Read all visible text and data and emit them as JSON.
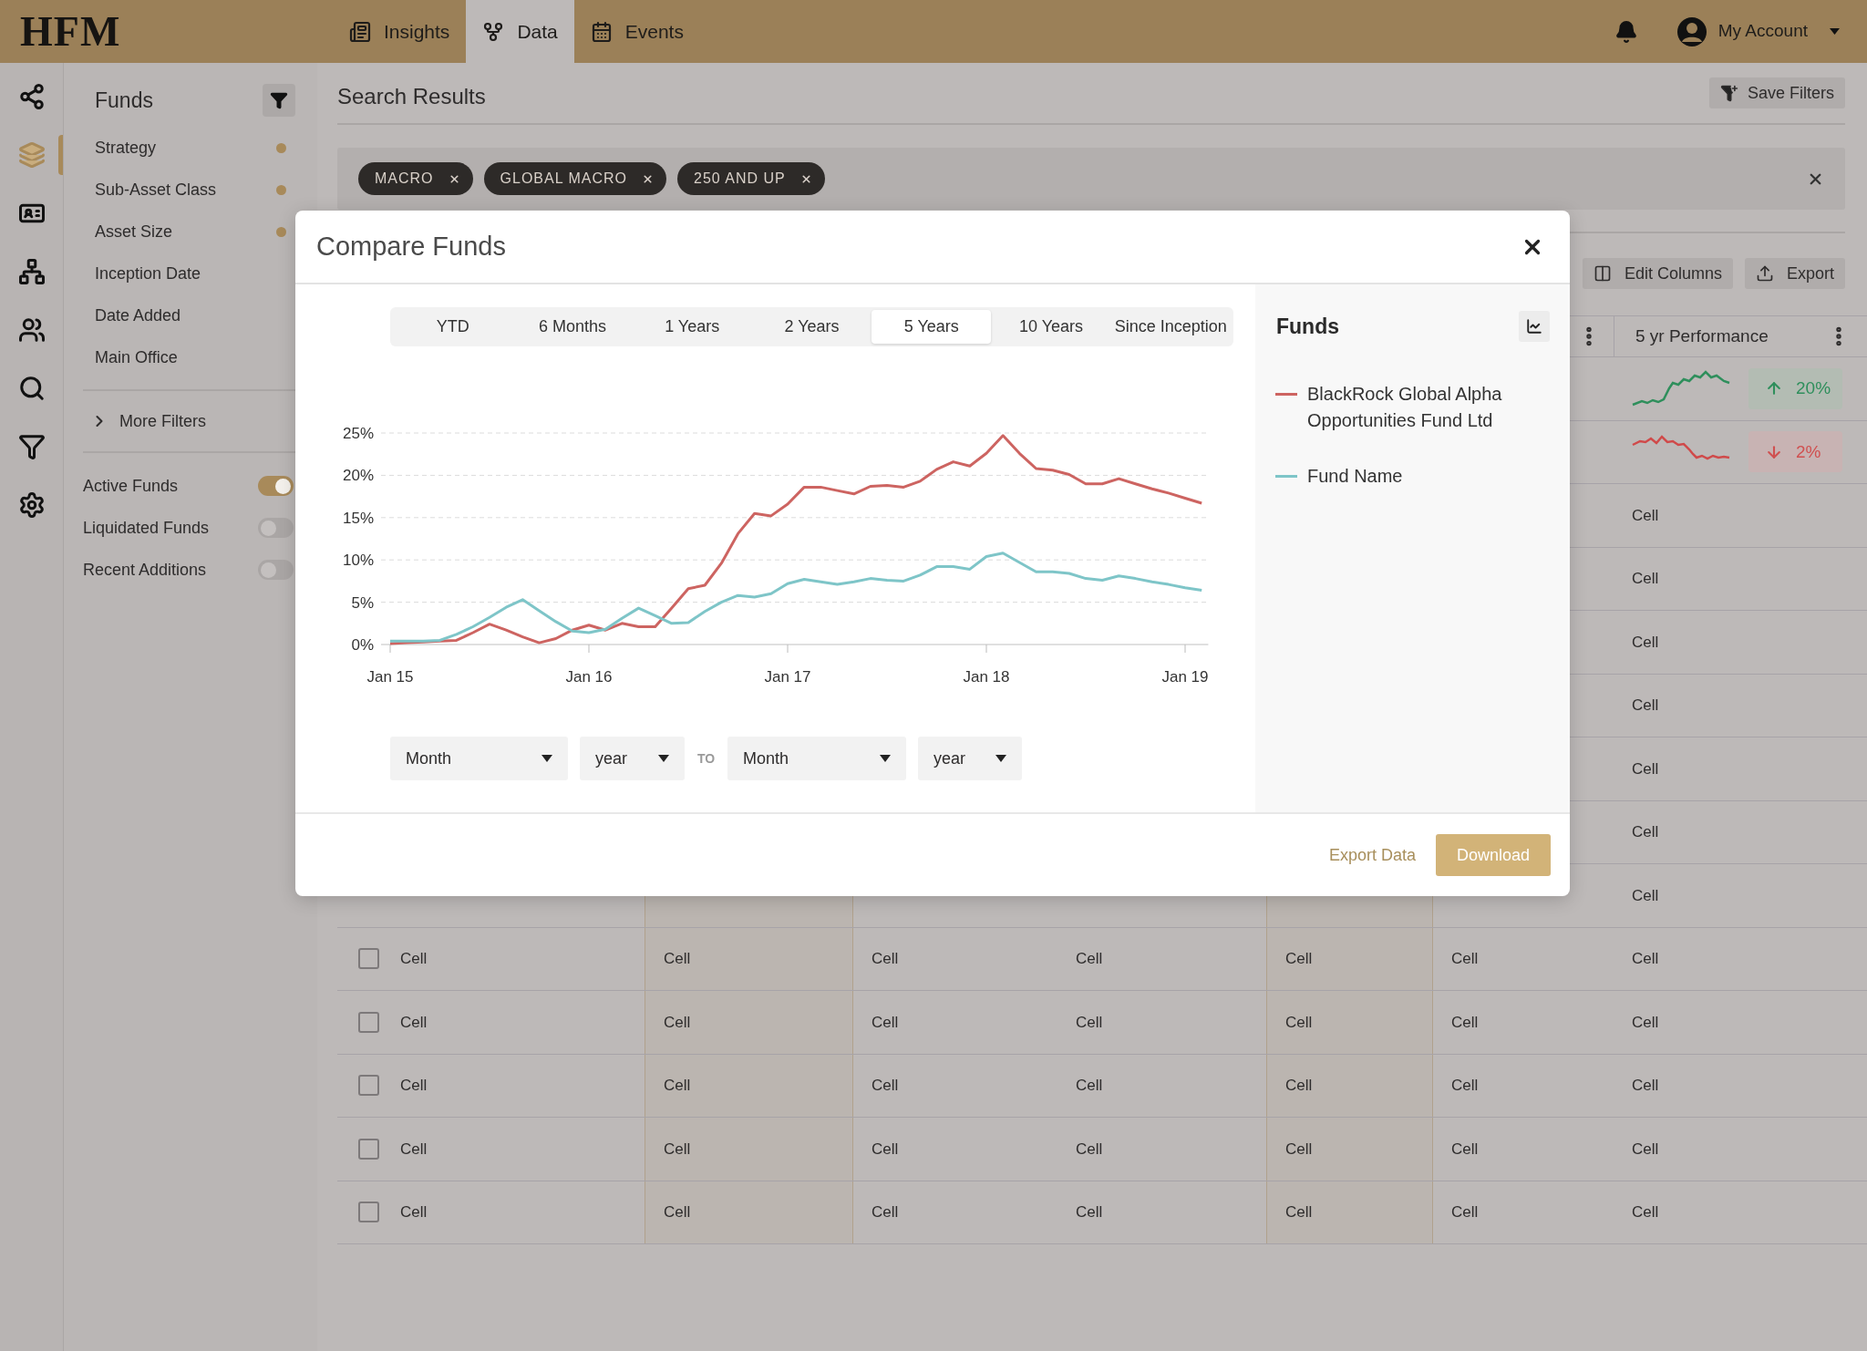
{
  "top_bar": {
    "logo": "HFM",
    "tabs": [
      {
        "label": "Insights",
        "kind": "insights",
        "selected": false
      },
      {
        "label": "Data",
        "kind": "data",
        "selected": true
      },
      {
        "label": "Events",
        "kind": "events",
        "selected": false
      }
    ],
    "account": "My Account"
  },
  "rail": [
    {
      "kind": "hub",
      "selected": false
    },
    {
      "kind": "layers",
      "selected": true
    },
    {
      "kind": "card",
      "selected": false
    },
    {
      "kind": "hierarchy",
      "selected": false
    },
    {
      "kind": "people",
      "selected": false
    },
    {
      "kind": "search",
      "selected": false
    },
    {
      "kind": "filter",
      "selected": false
    },
    {
      "kind": "settings",
      "selected": false
    }
  ],
  "filters": {
    "title": "Funds",
    "items": [
      {
        "label": "Strategy",
        "active": true
      },
      {
        "label": "Sub-Asset Class",
        "active": true
      },
      {
        "label": "Asset Size",
        "active": true
      },
      {
        "label": "Inception Date",
        "active": false
      },
      {
        "label": "Date Added",
        "active": false
      },
      {
        "label": "Main Office",
        "active": false
      }
    ],
    "more": "More Filters",
    "toggles": [
      {
        "label": "Active Funds",
        "on": true
      },
      {
        "label": "Liquidated Funds",
        "on": false
      },
      {
        "label": "Recent Additions",
        "on": false
      }
    ]
  },
  "results": {
    "title": "Search Results",
    "save_button": "Save Filters",
    "chips": [
      "MACRO",
      "GLOBAL MACRO",
      "250 AND UP"
    ],
    "toolbar": [
      {
        "label": "Edit Columns",
        "kind": "columns"
      },
      {
        "label": "Export",
        "kind": "export"
      }
    ]
  },
  "table": {
    "last_column": "5 yr Performance",
    "rows": [
      {
        "kind": "gain",
        "change": "20%"
      },
      {
        "kind": "loss",
        "change": "2%"
      },
      {
        "kind": "cells",
        "cells": [
          "Cell"
        ]
      },
      {
        "kind": "cells",
        "cells": [
          "Cell"
        ]
      },
      {
        "kind": "cells",
        "cells": [
          "Cell"
        ]
      },
      {
        "kind": "cells",
        "cells": [
          "Cell"
        ]
      },
      {
        "kind": "cells",
        "cells": [
          "Cell"
        ]
      },
      {
        "kind": "cells",
        "cells": [
          "Cell"
        ]
      },
      {
        "kind": "cells",
        "cells": [
          "Cell"
        ]
      },
      {
        "kind": "cells",
        "checked": false,
        "cells": [
          "Cell",
          "Cell",
          "Cell",
          "Cell",
          "Cell",
          "Cell",
          "Cell"
        ]
      },
      {
        "kind": "cells",
        "checked": false,
        "cells": [
          "Cell",
          "Cell",
          "Cell",
          "Cell",
          "Cell",
          "Cell",
          "Cell"
        ]
      },
      {
        "kind": "cells",
        "checked": false,
        "cells": [
          "Cell",
          "Cell",
          "Cell",
          "Cell",
          "Cell",
          "Cell",
          "Cell"
        ]
      },
      {
        "kind": "cells",
        "checked": false,
        "cells": [
          "Cell",
          "Cell",
          "Cell",
          "Cell",
          "Cell",
          "Cell",
          "Cell"
        ]
      },
      {
        "kind": "cells",
        "checked": false,
        "cells": [
          "Cell",
          "Cell",
          "Cell",
          "Cell",
          "Cell",
          "Cell",
          "Cell"
        ]
      }
    ]
  },
  "modal": {
    "title": "Compare Funds",
    "periods": [
      {
        "label": "YTD",
        "selected": false
      },
      {
        "label": "6 Months",
        "selected": false
      },
      {
        "label": "1 Years",
        "selected": false
      },
      {
        "label": "2 Years",
        "selected": false
      },
      {
        "label": "5 Years",
        "selected": true
      },
      {
        "label": "10 Years",
        "selected": false
      },
      {
        "label": "Since Inception",
        "selected": false
      }
    ],
    "chart_data": {
      "type": "line",
      "categories": [
        "Jan 15",
        null,
        null,
        null,
        null,
        null,
        null,
        null,
        null,
        null,
        null,
        null,
        "Jan 16",
        null,
        null,
        null,
        null,
        null,
        null,
        null,
        null,
        null,
        null,
        null,
        "Jan 17",
        null,
        null,
        null,
        null,
        null,
        null,
        null,
        null,
        null,
        null,
        null,
        "Jan 18",
        null,
        null,
        null,
        null,
        null,
        null,
        null,
        null,
        null,
        null,
        null,
        "Jan 19",
        null
      ],
      "series": [
        {
          "name": "BlackRock Global Alpha Opportunities Fund Ltd",
          "color": "#cd6461",
          "values": [
            0.1,
            0.2,
            0.3,
            0.4,
            0.5,
            1.4,
            2.4,
            1.7,
            0.9,
            0.2,
            0.7,
            1.7,
            2.3,
            1.7,
            2.5,
            2.1,
            2.1,
            4.3,
            6.6,
            7.0,
            9.6,
            13.1,
            15.5,
            15.2,
            16.6,
            18.6,
            18.6,
            18.2,
            17.8,
            18.7,
            18.8,
            18.6,
            19.3,
            20.7,
            21.6,
            21.1,
            22.6,
            24.7,
            22.6,
            20.8,
            20.6,
            20.1,
            19.0,
            19.0,
            19.6,
            19.0,
            18.4,
            17.9,
            17.3,
            16.7
          ]
        },
        {
          "name": "Fund Name",
          "color": "#7ec5c8",
          "values": [
            0.4,
            0.4,
            0.4,
            0.5,
            1.2,
            2.1,
            3.2,
            4.4,
            5.3,
            4.0,
            2.7,
            1.6,
            1.4,
            1.8,
            3.1,
            4.3,
            3.4,
            2.5,
            2.6,
            3.9,
            5.0,
            5.8,
            5.6,
            6.0,
            7.2,
            7.7,
            7.4,
            7.1,
            7.4,
            7.8,
            7.6,
            7.5,
            8.2,
            9.2,
            9.2,
            8.9,
            10.4,
            10.8,
            9.7,
            8.6,
            8.6,
            8.4,
            7.8,
            7.6,
            8.1,
            7.8,
            7.4,
            7.1,
            6.7,
            6.4
          ]
        }
      ],
      "ylim": [
        0,
        25
      ],
      "grid": true,
      "yticks": [
        {
          "value": 0,
          "label": "0%"
        },
        {
          "value": 5,
          "label": "5%"
        },
        {
          "value": 10,
          "label": "10%"
        },
        {
          "value": 15,
          "label": "15%"
        },
        {
          "value": 20,
          "label": "20%"
        },
        {
          "value": 25,
          "label": "25%"
        }
      ]
    },
    "range": {
      "from_month": "Month",
      "from_year": "year",
      "separator": "TO",
      "to_month": "Month",
      "to_year": "year"
    },
    "legend_title": "Funds",
    "export_link": "Export Data",
    "download_button": "Download"
  }
}
